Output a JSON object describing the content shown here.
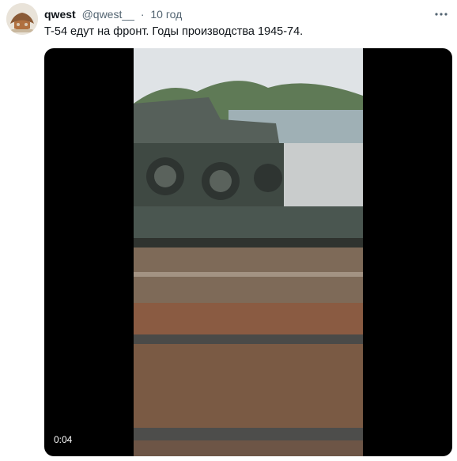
{
  "tweet": {
    "display_name": "qwest",
    "handle": "@qwest__",
    "separator": "·",
    "time": "10 год",
    "text": "T-54 едут на фронт. Годы производства 1945-74."
  },
  "media": {
    "duration": "0:04"
  },
  "icons": {
    "more": "more-dots-icon",
    "avatar": "avatar-image"
  }
}
